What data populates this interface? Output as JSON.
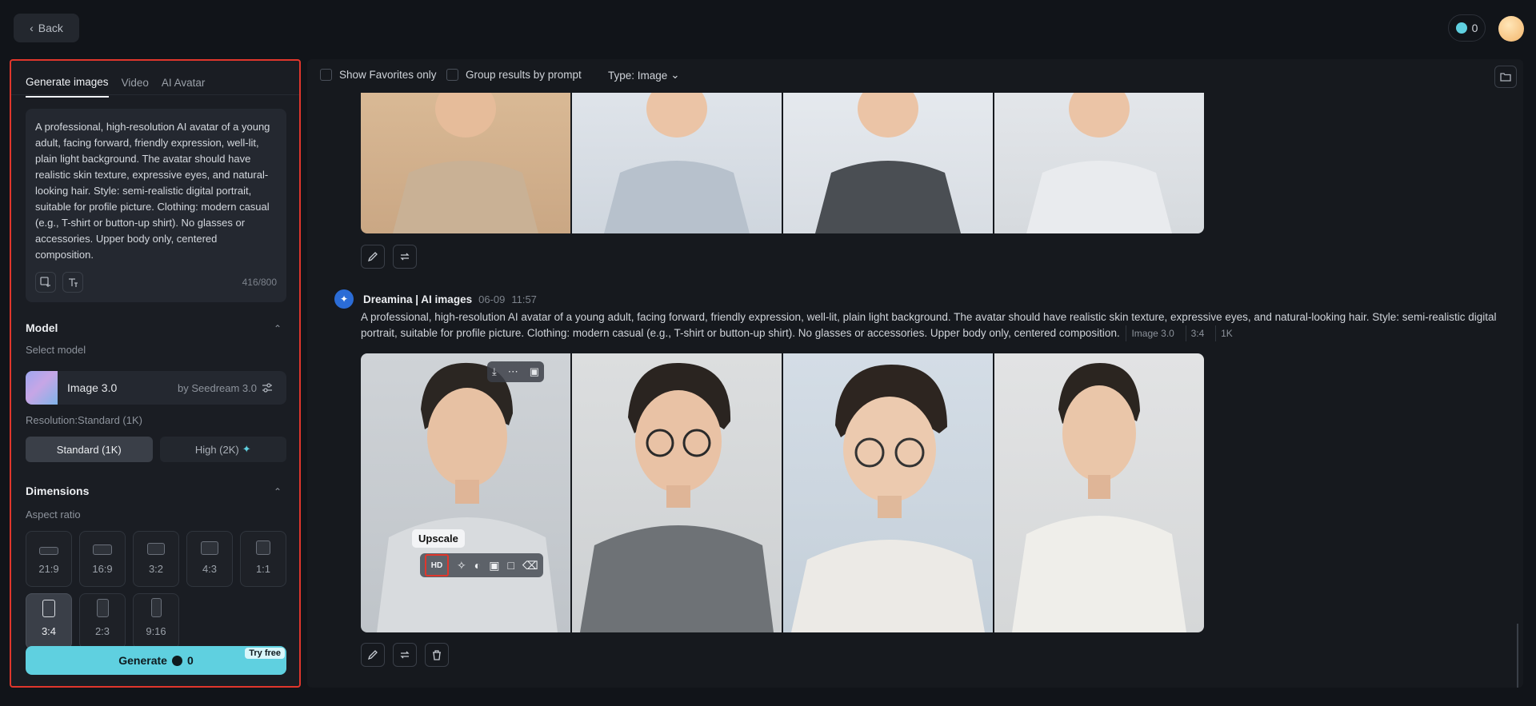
{
  "top": {
    "back_label": "Back",
    "credits": "0"
  },
  "tabs": [
    "Generate images",
    "Video",
    "AI Avatar"
  ],
  "prompt": {
    "text": "A professional, high-resolution AI avatar of a young adult, facing forward, friendly expression, well-lit, plain light background. The avatar should have realistic skin texture, expressive eyes, and natural-looking hair. Style: semi-realistic digital portrait, suitable for profile picture. Clothing: modern casual (e.g., T-shirt or button-up shirt). No glasses or accessories. Upper body only, centered composition.",
    "count": "416/800"
  },
  "model": {
    "section": "Model",
    "select_label": "Select model",
    "name": "Image 3.0",
    "by": "by Seedream 3.0",
    "resolution_label": "Resolution:Standard (1K)",
    "res_standard": "Standard (1K)",
    "res_high": "High (2K)"
  },
  "dimensions": {
    "section": "Dimensions",
    "aspect_label": "Aspect ratio",
    "ratios": [
      "21:9",
      "16:9",
      "3:2",
      "4:3",
      "1:1",
      "3:4",
      "2:3",
      "9:16"
    ],
    "selected": "3:4"
  },
  "generate": {
    "label": "Generate",
    "cost": "0",
    "badge": "Try free"
  },
  "filters": {
    "favorites": "Show Favorites only",
    "group": "Group results by prompt",
    "type": "Type: Image"
  },
  "post": {
    "author": "Dreamina | AI images",
    "date": "06-09",
    "time": "11:57",
    "prompt": "A professional, high-resolution AI avatar of a young adult, facing forward, friendly expression, well-lit, plain light background. The avatar should have realistic skin texture, expressive eyes, and natural-looking hair. Style: semi-realistic digital portrait, suitable for profile picture. Clothing: modern casual (e.g., T-shirt or button-up shirt). No glasses or accessories. Upper body only, centered composition.",
    "tags": [
      "Image 3.0",
      "3:4",
      "1K"
    ]
  },
  "tooltip": {
    "upscale": "Upscale",
    "hd": "HD"
  },
  "colors": {
    "accent": "#5fd0e0",
    "highlight": "#e0362c"
  }
}
